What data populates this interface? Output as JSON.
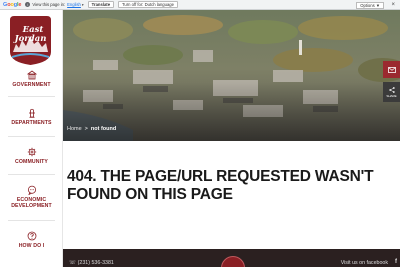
{
  "translate_bar": {
    "brand": [
      "G",
      "o",
      "o",
      "g",
      "l",
      "e"
    ],
    "info_icon": "info-icon",
    "prompt": "View this page in:",
    "language": "English",
    "translate_label": "Translate",
    "turn_off_label": "Turn off for: Dutch language",
    "options_label": "Options ▼",
    "close_glyph": "×"
  },
  "brand": {
    "top": "East",
    "bottom": "Jordan"
  },
  "sidebar": {
    "items": [
      {
        "label": "GOVERNMENT",
        "icon": "building-icon"
      },
      {
        "label": "DEPARTMENTS",
        "icon": "fire-hydrant-icon"
      },
      {
        "label": "COMMUNITY",
        "icon": "gear-icon"
      },
      {
        "label": "ECONOMIC DEVELOPMENT",
        "icon": "chat-bubble-icon"
      },
      {
        "label": "HOW DO I",
        "icon": "question-icon"
      }
    ]
  },
  "breadcrumb": {
    "home": "Home",
    "separator": ">",
    "current": "not found"
  },
  "actions": {
    "share_label": "SHARE"
  },
  "main": {
    "title": "404. THE PAGE/URL REQUESTED WASN'T FOUND ON THIS PAGE"
  },
  "footer": {
    "phone": "(231) 536-3381",
    "facebook": "Visit us on facebook",
    "facebook_glyph": "f"
  },
  "colors": {
    "brand_maroon": "#8a1f24",
    "footer_bg": "#2b2020"
  }
}
